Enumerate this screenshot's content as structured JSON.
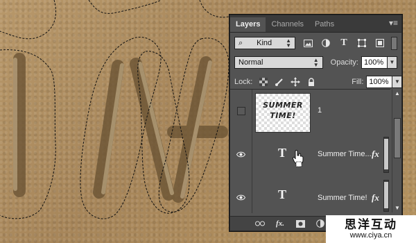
{
  "layers_panel": {
    "tabs": [
      {
        "label": "Layers",
        "active": true
      },
      {
        "label": "Channels",
        "active": false
      },
      {
        "label": "Paths",
        "active": false
      }
    ],
    "filter": {
      "kind_label": "Kind",
      "icons": [
        "image-filter-icon",
        "adjustment-filter-icon",
        "type-filter-icon",
        "shape-filter-icon",
        "smart-object-filter-icon"
      ]
    },
    "blend_mode": "Normal",
    "opacity_label": "Opacity:",
    "opacity_value": "100%",
    "lock_label": "Lock:",
    "fill_label": "Fill:",
    "fill_value": "100%",
    "layers": [
      {
        "name": "1",
        "type": "pixel",
        "visible": false,
        "thumbnail_text": [
          "SUMMER",
          "TIME!"
        ],
        "fx": false
      },
      {
        "name": "Summer Time...",
        "type": "text",
        "visible": true,
        "fx": true
      },
      {
        "name": "Summer Time!",
        "type": "text",
        "visible": true,
        "fx": true
      }
    ],
    "fx_label": "fx",
    "text_layer_glyph": "T"
  },
  "watermark": {
    "title": "思洋互动",
    "url": "www.ciya.cn"
  }
}
